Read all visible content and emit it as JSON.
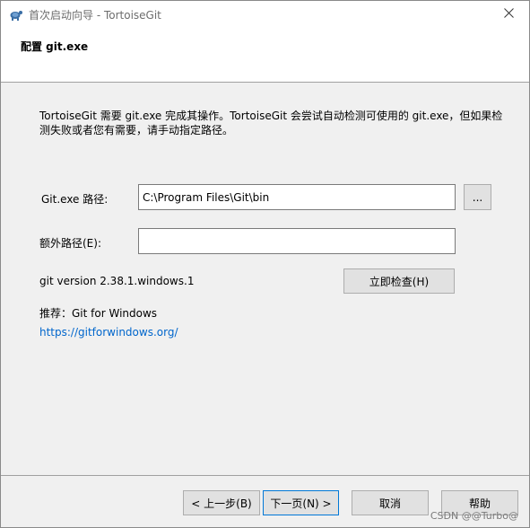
{
  "window": {
    "title": "首次启动向导 - TortoiseGit",
    "icon": "tortoisegit-icon",
    "close_glyph": "✕"
  },
  "header": {
    "title": "配置 git.exe"
  },
  "description": "TortoiseGit 需要 git.exe 完成其操作。TortoiseGit 会尝试自动检测可使用的 git.exe，但如果检测失败或者您有需要，请手动指定路径。",
  "git_path": {
    "label": "Git.exe 路径:",
    "value": "C:\\Program Files\\Git\\bin",
    "browse_label": "..."
  },
  "extra_path": {
    "label": "额外路径(E):",
    "value": ""
  },
  "version": {
    "text": "git version 2.38.1.windows.1",
    "check_button": "立即检查(H)"
  },
  "recommend": {
    "text": "推荐：Git for Windows",
    "link": "https://gitforwindows.org/"
  },
  "footer": {
    "back": "< 上一步(B)",
    "next": "下一页(N) >",
    "cancel": "取消",
    "help": "帮助"
  },
  "watermark": "CSDN @@Turbo@",
  "colors": {
    "dialog_bg": "#f0f0f0",
    "link": "#0066cc",
    "default_button_border": "#0078d7"
  }
}
